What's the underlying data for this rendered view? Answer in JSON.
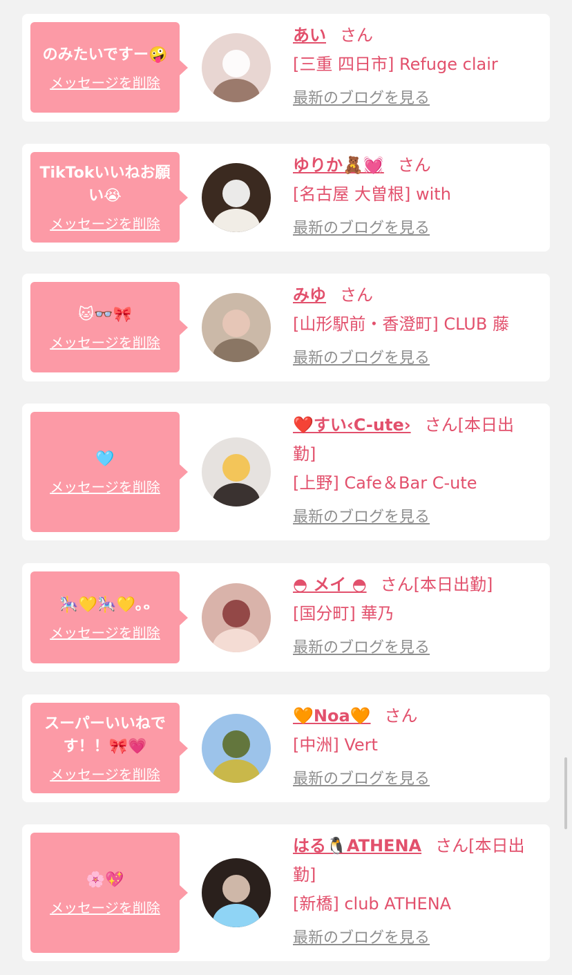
{
  "accent_color": "#fc9aa6",
  "name_color": "#e2506c",
  "link_color": "#8e8e8e",
  "delete_label": "メッセージを削除",
  "blog_label": "最新のブログを見る",
  "items": [
    {
      "message": "のみたいですー🤪",
      "name": "あい",
      "honorific": "さん",
      "shop": "[三重 四日市] Refuge clair",
      "avatar_colors": [
        "#e8d6d2",
        "#9b7a6c",
        "#ffffff"
      ]
    },
    {
      "message": "TikTokいいねお願い😭",
      "name": "ゆりか🧸💓",
      "honorific": "さん",
      "shop": "[名古屋 大曽根] with",
      "avatar_colors": [
        "#3b2a20",
        "#f1ede6",
        "#ffffff"
      ]
    },
    {
      "message": "🐱👓🎀",
      "name": "みゆ",
      "honorific": "さん",
      "shop": "[山形駅前・香澄町] CLUB 藤",
      "avatar_colors": [
        "#cbb9a8",
        "#8a7664",
        "#e9c8b8"
      ]
    },
    {
      "message": "🩵",
      "name": "❤️すい‹C-ute›",
      "honorific": "さん[本日出勤]",
      "shop": "[上野] Cafe＆Bar C-ute",
      "avatar_colors": [
        "#e6e2df",
        "#3a3230",
        "#f4c24a"
      ]
    },
    {
      "message": "🎠💛🎠💛｡ₒ",
      "name": "◓ メイ ◓",
      "honorific": "さん[本日出勤]",
      "shop": "[国分町] 華乃",
      "avatar_colors": [
        "#d9b3aa",
        "#f4dcd4",
        "#8b3c3c"
      ]
    },
    {
      "message": "スーパーいいねです！！🎀💗",
      "name": "🧡Noa🧡",
      "honorific": "さん",
      "shop": "[中洲] Vert",
      "avatar_colors": [
        "#9cc3ea",
        "#c9b84a",
        "#5d6e2a"
      ]
    },
    {
      "message": "🌸💖",
      "name": "はる🐧ATHENA",
      "honorific": "さん[本日出勤]",
      "shop": "[新橋] club ATHENA",
      "avatar_colors": [
        "#2a201c",
        "#8fd4f5",
        "#e0c8b8"
      ]
    }
  ]
}
